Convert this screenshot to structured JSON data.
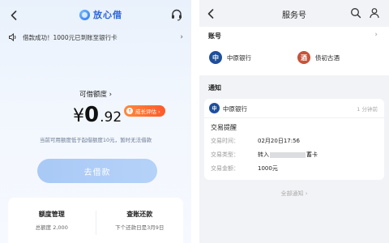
{
  "left": {
    "header": {
      "brand_name": "放心借",
      "back_icon": "chevron-left-icon",
      "service_icon": "headset-icon"
    },
    "notice": {
      "text": "借款成功！1000元已到账至银行卡",
      "icon": "speaker-icon",
      "arrow": "›"
    },
    "credit": {
      "label": "可借额度 ›",
      "currency": "¥",
      "amount_int": "0",
      "amount_dec": ".92",
      "boost_label": "成长评估 ›",
      "boost_icon": "boost-icon",
      "hint": "当前可用额度低于起借额度10元，暂时无法借款"
    },
    "borrow_button": "去借款",
    "bottom": {
      "quota_title": "额度管理",
      "quota_sub": "总额度 2,000",
      "repay_title": "查账还款",
      "repay_sub": "下个还款日是3月9日"
    },
    "colors": {
      "brand": "#2a62d8",
      "boost": "#ff6a30",
      "button": "#b0cdf7"
    }
  },
  "right": {
    "header": {
      "title": "服务号",
      "back_icon": "chevron-left-icon",
      "search_icon": "search-icon",
      "user_icon": "user-icon"
    },
    "accounts": {
      "label": "账号",
      "arrow": "›",
      "items": [
        {
          "name": "中原银行",
          "logo_char": "中",
          "color": "#1f4e9c"
        },
        {
          "name": "债初古酒",
          "logo_char": "酒",
          "color": "#c8523a"
        }
      ]
    },
    "notices": {
      "label": "通知",
      "card": {
        "bank": "中原银行",
        "logo_char": "中",
        "time": "1 分钟前",
        "type": "交易提醒",
        "fields": [
          {
            "label": "交易时间：",
            "value": "02月20日17:56"
          },
          {
            "label": "交易类型：",
            "value_prefix": "转入",
            "value_suffix": "蓄卡"
          },
          {
            "label": "交易金额：",
            "value": "1000元"
          }
        ]
      },
      "more": "全部通知 ›"
    }
  }
}
